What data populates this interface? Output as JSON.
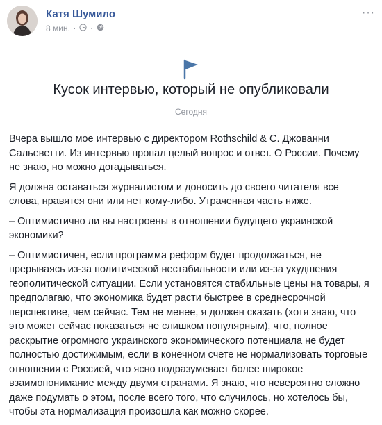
{
  "post": {
    "author": "Катя Шумило",
    "time": "8 мин.",
    "dot": "·",
    "more": "···"
  },
  "note": {
    "title": "Кусок интервью, который не опубликовали",
    "date": "Сегодня",
    "paragraphs": [
      "Вчера вышло мое интервью с директором Rothschild & C. Джованни Сальеветти. Из интервью пропал целый вопрос и ответ. О России. Почему не знаю, но можно догадываться.",
      "Я должна оставаться журналистом и доносить до своего читателя все слова, нравятся они или нет кому-либо. Утраченная часть ниже.",
      "– Оптимистично ли вы настроены в отношении будущего украинской экономики?",
      "– Оптимистичен, если программа реформ будет продолжаться, не прерываясь из-за политической нестабильности или из-за ухудшения геополитической ситуации. Если установятся стабильные цены на товары, я предполагаю, что экономика будет расти быстрее в среднесрочной перспективе, чем сейчас. Тем не менее, я должен сказать (хотя знаю, что это может сейчас показаться не слишком популярным), что, полное раскрытие огромного украинского экономического потенциала не будет полностью достижимым, если в конечном счете не нормализовать торговые отношения с Россией, что ясно подразумевает более широкое взаимопонимание между двумя странами. Я знаю, что невероятно сложно даже подумать о этом, после всего того, что случилось, но хотелось бы, чтобы эта нормализация произошла как можно скорее."
    ]
  },
  "icons": {
    "avatar": "avatar",
    "clock": "clock-icon",
    "globe": "globe-icon",
    "flag": "flag-icon",
    "flag_color": "#4a76a8"
  }
}
